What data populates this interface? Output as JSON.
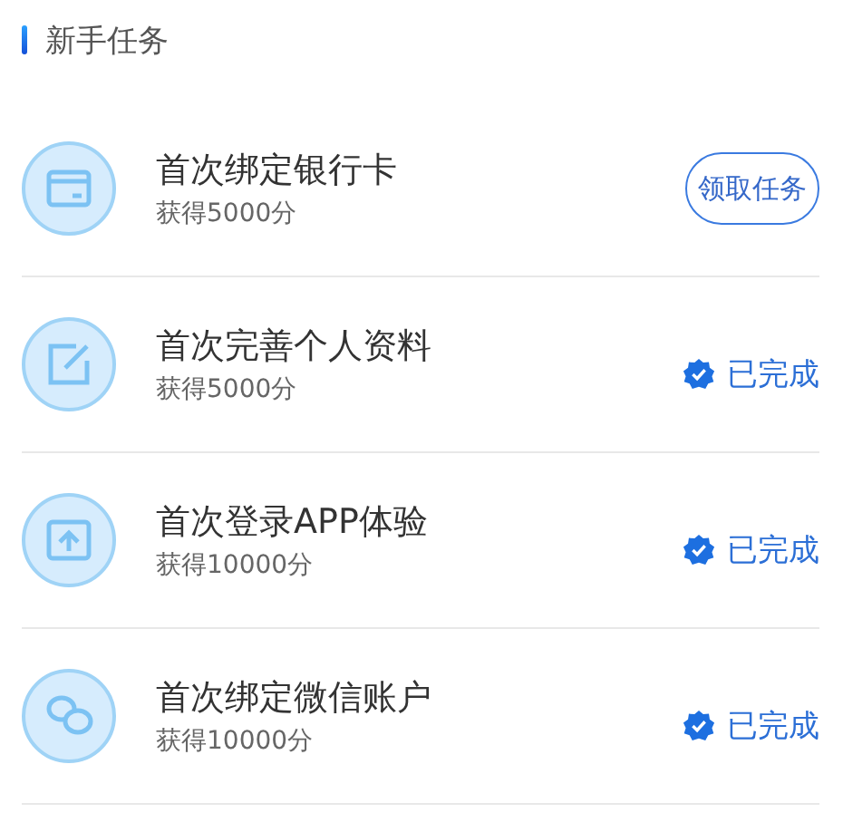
{
  "section": {
    "title": "新手任务"
  },
  "tasks": [
    {
      "title": "首次绑定银行卡",
      "reward": "获得5000分",
      "kind": "claim",
      "action": "领取任务"
    },
    {
      "title": "首次完善个人资料",
      "reward": "获得5000分",
      "kind": "done",
      "action": "已完成"
    },
    {
      "title": "首次登录APP体验",
      "reward": "获得10000分",
      "kind": "done",
      "action": "已完成"
    },
    {
      "title": "首次绑定微信账户",
      "reward": "获得10000分",
      "kind": "done",
      "action": "已完成"
    }
  ]
}
